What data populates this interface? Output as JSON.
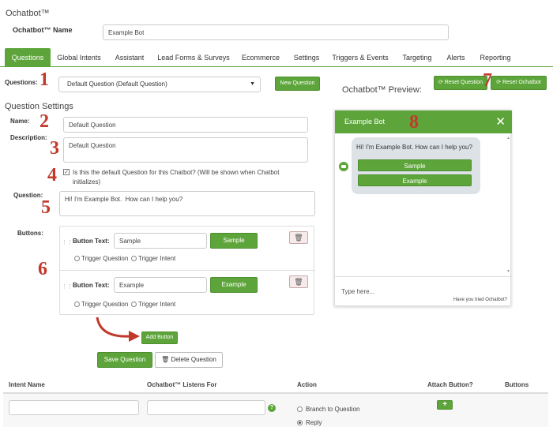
{
  "app": {
    "title": "Ochatbot™"
  },
  "header": {
    "name_label": "Ochatbot™ Name",
    "name_value": "Example Bot"
  },
  "tabs": [
    {
      "label": "Questions",
      "active": true
    },
    {
      "label": "Global Intents"
    },
    {
      "label": "Assistant"
    },
    {
      "label": "Lead Forms & Surveys"
    },
    {
      "label": "Ecommerce"
    },
    {
      "label": "Settings"
    },
    {
      "label": "Triggers & Events"
    },
    {
      "label": "Targeting"
    },
    {
      "label": "Alerts"
    },
    {
      "label": "Reporting"
    }
  ],
  "questions": {
    "label": "Questions:",
    "selected": "Default Question (Default Question)",
    "new_button": "New Question"
  },
  "preview_controls": {
    "title": "Ochatbot™ Preview:",
    "reset_question": "Reset Question",
    "reset_ochatbot": "Reset Ochatbot"
  },
  "settings": {
    "section_title": "Question Settings",
    "name_label": "Name:",
    "name_value": "Default Question",
    "description_label": "Description:",
    "description_value": "Default Question",
    "default_checkbox": "Is this the default Question for this Chatbot? (Will be shown when Chatbot initializes)",
    "default_checked": true,
    "question_label": "Question:",
    "question_value": "Hi! I'm Example Bot.  How can I help you?",
    "buttons_label": "Buttons:",
    "button_text_label": "Button Text:",
    "trigger_question": "Trigger Question",
    "trigger_intent": "Trigger Intent",
    "buttons": [
      {
        "text": "Sample"
      },
      {
        "text": "Example"
      }
    ],
    "add_button": "Add Button",
    "save_button": "Save Question",
    "delete_button": "Delete Question"
  },
  "annotations": [
    "1",
    "2",
    "3",
    "4",
    "5",
    "6",
    "7",
    "8"
  ],
  "preview": {
    "bot_name": "Example Bot",
    "message": "Hi! I'm Example Bot.  How can I help you?",
    "chips": [
      "Sample",
      "Example"
    ],
    "input_placeholder": "Type here...",
    "tried_text": "Have you tried Ochatbot?"
  },
  "table": {
    "headers": [
      "Intent Name",
      "Ochatbot™ Listens For",
      "Action",
      "Attach Button?",
      "Buttons"
    ],
    "action_options": [
      "Branch to Question",
      "Reply"
    ],
    "selected_action": "Reply",
    "attach_button": "+"
  },
  "colors": {
    "accent": "#5da53a",
    "annotation": "#c0392b"
  }
}
